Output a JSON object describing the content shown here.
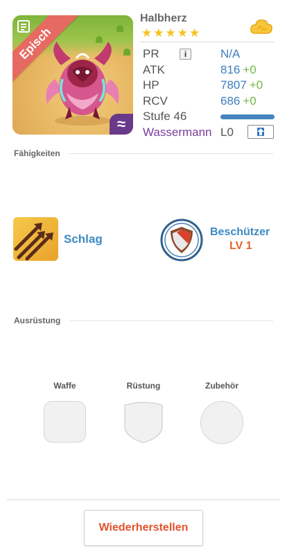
{
  "monster": {
    "name": "Halbherz",
    "rarity_label": "Episch",
    "stars": [
      "★",
      "★",
      "★",
      "★",
      "★"
    ],
    "element_symbol": "≈",
    "element_icon": "water-wave-icon",
    "rarity_color": "#e66a62"
  },
  "stats": {
    "pr": {
      "label": "PR",
      "value": "N/A",
      "info_label": "i"
    },
    "atk": {
      "label": "ATK",
      "value": "816",
      "bonus": "+0"
    },
    "hp": {
      "label": "HP",
      "value": "7807",
      "bonus": "+0"
    },
    "rcv": {
      "label": "RCV",
      "value": "686",
      "bonus": "+0"
    },
    "level": {
      "label": "Stufe 46",
      "progress": 1.0
    },
    "sign": {
      "label": "Wassermann",
      "value": "L0"
    }
  },
  "sections": {
    "skills_title": "Fähigkeiten",
    "equipment_title": "Ausrüstung"
  },
  "skills": {
    "active": {
      "name": "Schlag",
      "icon": "triple-arrow-icon"
    },
    "leader": {
      "name": "Beschützer",
      "level": "LV 1",
      "icon": "shield-icon"
    }
  },
  "equipment": {
    "weapon_label": "Waffe",
    "armor_label": "Rüstung",
    "accessory_label": "Zubehör"
  },
  "actions": {
    "restore_label": "Wiederherstellen"
  },
  "colors": {
    "accent_blue": "#3d8ac3",
    "bonus_green": "#74b843",
    "sign_purple": "#7b3c98",
    "restore_red": "#e0532b",
    "star_gold": "#f5c21b"
  }
}
